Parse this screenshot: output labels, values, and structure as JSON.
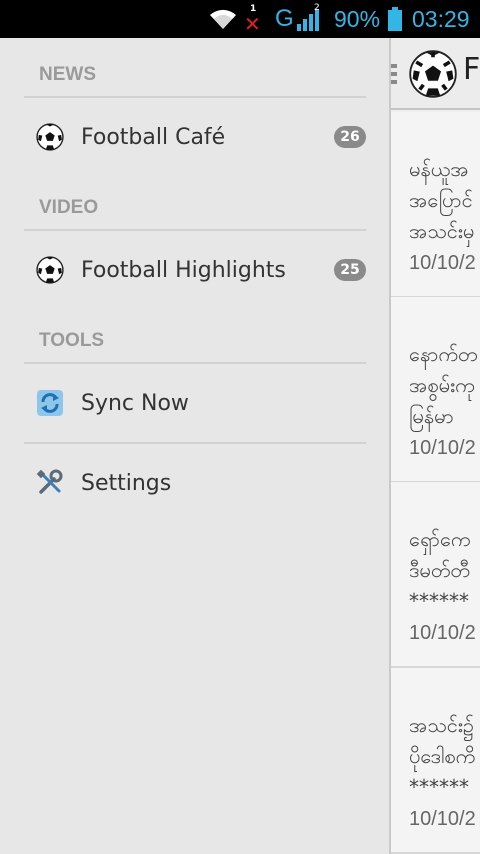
{
  "status_bar": {
    "sim_index": "1",
    "network_type": "G",
    "signal_index": "2",
    "battery_percent": "90%",
    "time": "03:29"
  },
  "app_header": {
    "title": "Fo"
  },
  "drawer": {
    "news_section": "NEWS",
    "video_section": "VIDEO",
    "tools_section": "TOOLS",
    "items": [
      {
        "label": "Football Café",
        "count": "26",
        "icon": "soccer-ball-icon"
      },
      {
        "label": "Football Highlights",
        "count": "25",
        "icon": "soccer-ball-icon"
      },
      {
        "label": "Sync Now",
        "icon": "sync-icon"
      },
      {
        "label": "Settings",
        "icon": "settings-icon"
      }
    ]
  },
  "articles": [
    {
      "lines": [
        "မန်ယူအ",
        "အပြောင်",
        "အသင်းမှ"
      ],
      "date": "10/10/2"
    },
    {
      "lines": [
        "နောက်တ",
        "အစွမ်းကု",
        "မြန်မာ"
      ],
      "date": "10/10/2"
    },
    {
      "lines": [
        "ရှော်ကေ",
        "ဒီမတ်တီ",
        "******"
      ],
      "date": "10/10/2"
    },
    {
      "lines": [
        "အသင်း၌",
        "ပိုဒေါစကိ",
        "******"
      ],
      "date": "10/10/2"
    }
  ],
  "colors": {
    "status_accent": "#33b5e5",
    "badge_bg": "#8a8a8a",
    "section_text": "#9a9a9a"
  }
}
